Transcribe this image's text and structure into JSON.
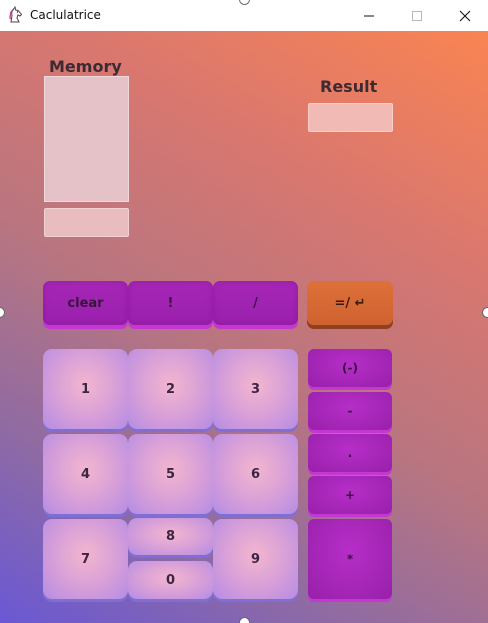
{
  "window": {
    "title": "Caclulatrice"
  },
  "labels": {
    "memory": "Memory",
    "result": "Result"
  },
  "buttons": {
    "clear": "clear",
    "factorial": "!",
    "divide": "/",
    "equals": "=/ ↵",
    "negate": "(-)",
    "minus": "-",
    "dot": ".",
    "plus": "+",
    "multiply": "*"
  },
  "digits": {
    "d0": "0",
    "d1": "1",
    "d2": "2",
    "d3": "3",
    "d4": "4",
    "d5": "5",
    "d6": "6",
    "d7": "7",
    "d8": "8",
    "d9": "9"
  },
  "colors": {
    "operator": "#a626b6",
    "equals": "#de7038",
    "number_center": "#f3b6ce",
    "number_edge": "#b48ce4",
    "gradient_top": "#fa8452",
    "gradient_bottom": "#6a58d4"
  }
}
